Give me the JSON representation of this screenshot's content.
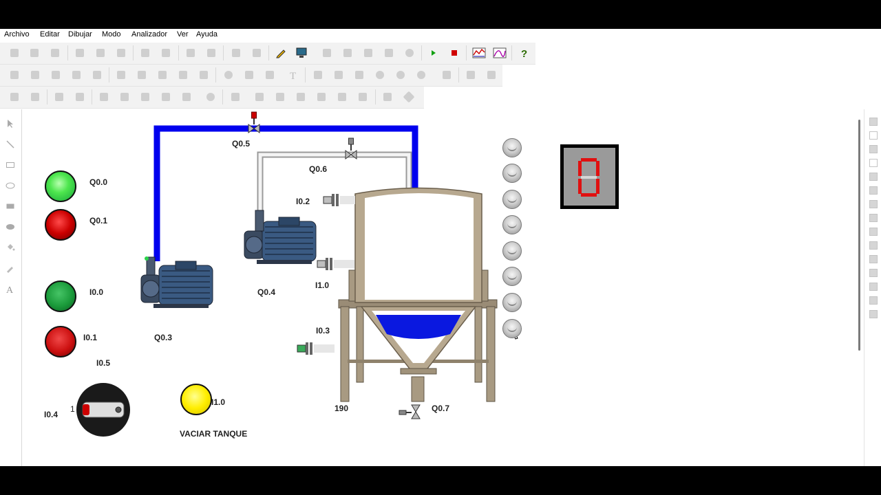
{
  "menu": [
    "Archivo",
    "Editar",
    "Dibujar",
    "Modo",
    "Analizador",
    "Ver",
    "Ayuda"
  ],
  "toolbar_icons": {
    "row1": [
      "new-file-icon",
      "open-folder-icon",
      "save-icon",
      "cut-icon",
      "copy-icon",
      "paste-icon",
      "undo-icon",
      "redo-icon",
      "group-icon",
      "ungroup-icon",
      "grid-icon",
      "snap-icon",
      "pencil-icon",
      "monitor-icon",
      "tool-a-icon",
      "tool-b-icon",
      "tool-c-icon",
      "tool-d-icon",
      "link-icon",
      "run-icon",
      "stop-icon",
      "chart-icon",
      "trend-icon",
      "help-icon"
    ]
  },
  "labels": {
    "q00": "Q0.0",
    "q01": "Q0.1",
    "i00": "I0.0",
    "i01": "I0.1",
    "i05": "I0.5",
    "i04": "I0.4",
    "selector_pos": "1",
    "q03": "Q0.3",
    "q04": "Q0.4",
    "q05": "Q0.5",
    "q06": "Q0.6",
    "q07": "Q0.7",
    "i02": "I0.2",
    "i03": "I0.3",
    "i10_sensor": "I1.0",
    "i10_button": "I1.0",
    "tank_level": "190",
    "drain_label": "VACIAR TANQUE"
  },
  "display": {
    "digit": "0"
  },
  "colors": {
    "pipe_blue": "#0000ee",
    "pipe_gray": "#bdbdbd",
    "water": "#0a18e0",
    "lamp_green_bright": "#4ee64e",
    "lamp_green": "#1a9a3a",
    "lamp_red": "#cc0000",
    "lamp_yellow": "#ffee00",
    "segment_red": "#e01010"
  },
  "tank": {
    "fill_level": 0.35
  }
}
